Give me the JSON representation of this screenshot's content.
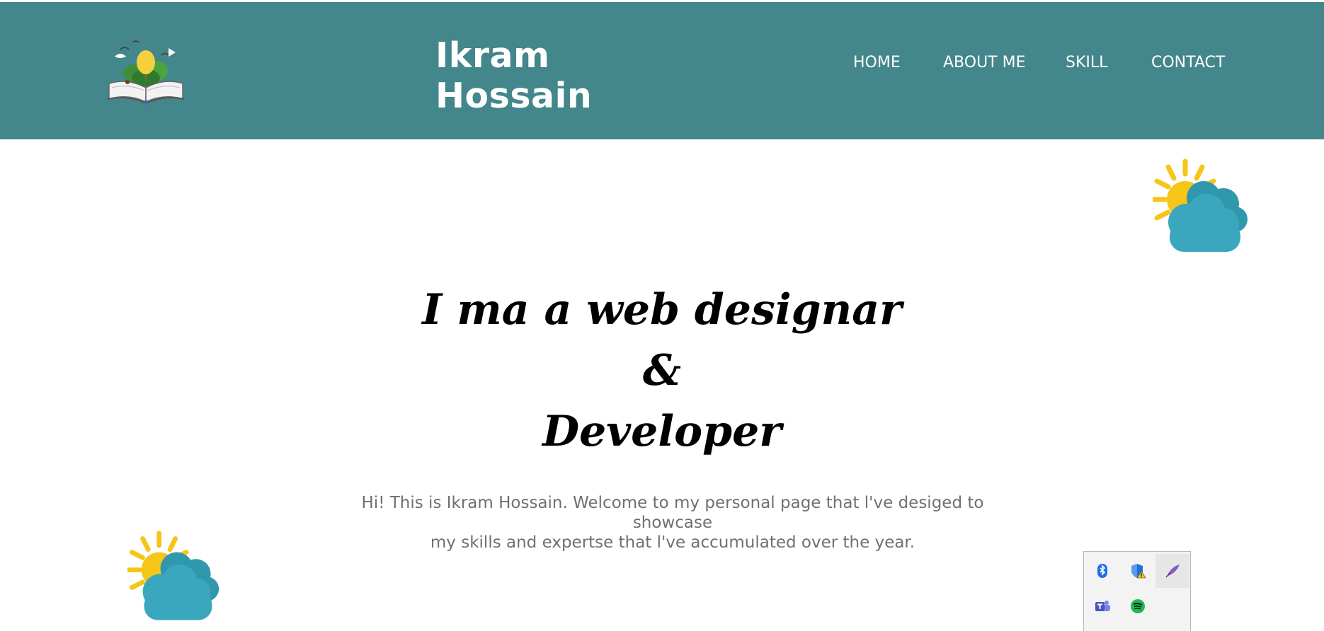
{
  "header": {
    "logo_name": "open-book-logo",
    "title": "Ikram Hossain",
    "nav": [
      {
        "label": "HOME"
      },
      {
        "label": "ABOUT ME"
      },
      {
        "label": "SKILL"
      },
      {
        "label": "CONTACT"
      }
    ],
    "background_color": "#43868b"
  },
  "hero": {
    "line1": "I ma a web designar",
    "line2": "&",
    "line3": "Developer",
    "intro_line1": "Hi! This is Ikram Hossain. Welcome to my personal page that l've desiged to showcase",
    "intro_line2": "my skills and expertse that l've accumulated over the year."
  },
  "decorations": {
    "icons": [
      "sun-cloud-icon",
      "sun-cloud-icon"
    ],
    "sun_color": "#f5c518",
    "cloud_color": "#3aa7be"
  },
  "system_tray": {
    "icons": [
      "bluetooth-icon",
      "security-warning-icon",
      "pen-icon",
      "teams-icon",
      "spotify-icon"
    ]
  }
}
